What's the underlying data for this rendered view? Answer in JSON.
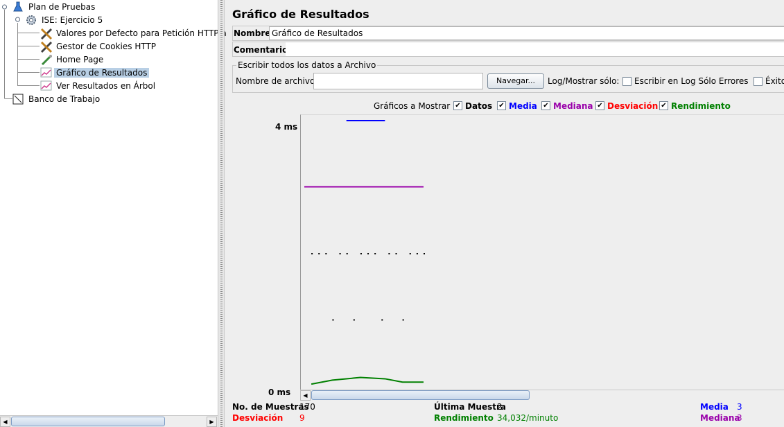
{
  "tree": {
    "root": "Plan de Pruebas",
    "group": "ISE: Ejercicio 5",
    "items": [
      {
        "label": "Valores por Defecto para Petición HTTP a"
      },
      {
        "label": "Gestor de Cookies HTTP"
      },
      {
        "label": "Home Page"
      },
      {
        "label": "Gráfico de Resultados"
      },
      {
        "label": "Ver Resultados en Árbol"
      }
    ],
    "workbench": "Banco de Trabajo"
  },
  "panel": {
    "title": "Gráfico de Resultados",
    "name_label": "Nombre:",
    "name_value": "Gráfico de Resultados",
    "comments_label": "Comentarios",
    "file_section_title": "Escribir todos los datos a Archivo",
    "filename_label": "Nombre de archivo",
    "filename_value": "",
    "browse_label": "Navegar...",
    "log_only_label": "Log/Mostrar sólo:",
    "errors_only_label": "Escribir en Log Sólo Errores",
    "success_label": "Éxitos"
  },
  "graph_options": {
    "label": "Gráficos a Mostrar",
    "items": [
      {
        "label": "Datos",
        "checked": true,
        "color": "#000000"
      },
      {
        "label": "Media",
        "checked": true,
        "color": "#0000ff"
      },
      {
        "label": "Mediana",
        "checked": true,
        "color": "#9900aa"
      },
      {
        "label": "Desviación",
        "checked": true,
        "color": "#ff0000"
      },
      {
        "label": "Rendimiento",
        "checked": true,
        "color": "#008000"
      }
    ]
  },
  "chart_data": {
    "type": "line",
    "ylabel_top": "4 ms",
    "ylabel_bottom": "0 ms",
    "ylim": [
      0,
      4
    ],
    "series": [
      {
        "name": "Mediana",
        "color": "#9900aa",
        "x": [
          0,
          170
        ],
        "y": [
          3,
          3
        ]
      },
      {
        "name": "Media",
        "color": "#0000ff",
        "x": [
          60,
          115
        ],
        "y": [
          4,
          4
        ]
      },
      {
        "name": "Rendimiento",
        "color": "#008000",
        "x": [
          10,
          40,
          80,
          115,
          140,
          170
        ],
        "y": [
          0.02,
          0.08,
          0.12,
          0.1,
          0.05,
          0.05
        ]
      },
      {
        "name": "Datos",
        "color": "#000000",
        "x": [
          10,
          20,
          30,
          40,
          50,
          60,
          70,
          80,
          90,
          100,
          110,
          120,
          130,
          140,
          150,
          160,
          170
        ],
        "y": [
          2,
          2,
          2,
          1,
          2,
          2,
          1,
          2,
          2,
          2,
          1,
          2,
          2,
          1,
          2,
          2,
          2
        ]
      }
    ]
  },
  "stats": {
    "samples_label": "No. de Muestras",
    "samples_value": "170",
    "last_label": "Última Muestra",
    "last_value": "2",
    "mean_label": "Media",
    "mean_value": "3",
    "deviation_label": "Desviación",
    "deviation_value": "9",
    "throughput_label": "Rendimiento",
    "throughput_value": "34,032/minuto",
    "median_label": "Mediana",
    "median_value": "3"
  },
  "colors": {
    "mean": "#0000ff",
    "median": "#9900aa",
    "deviation": "#ff0000",
    "throughput": "#008000"
  }
}
